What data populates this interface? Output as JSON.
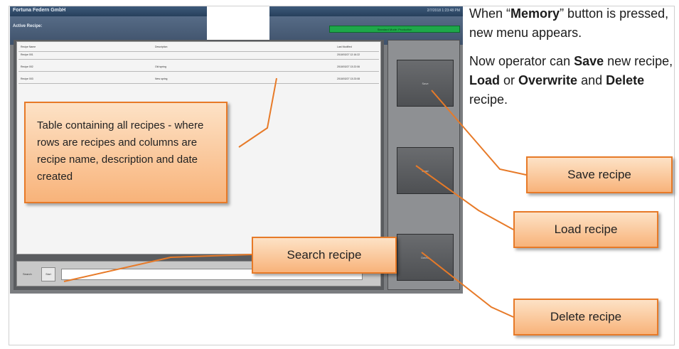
{
  "hmi": {
    "window_title": "Fortuna Federn GmbH",
    "datetime": "2/7/2018 1:23:48 PM",
    "active_recipe_label": "Active Recipe:",
    "mode_badge": "Standard Mode: Production",
    "table": {
      "headers": [
        "Recipe Name",
        "Description",
        "Last Modified"
      ],
      "rows": [
        [
          "Recipe 001",
          "",
          "2018/03/27 12:16:22"
        ],
        [
          "Recipe 002",
          "Old spring",
          "2018/03/27 13:22:06"
        ],
        [
          "Recipe 003",
          "New spring",
          "2018/03/27 13:23:08"
        ]
      ]
    },
    "search": {
      "label": "Search",
      "button": "Start",
      "input_value": ""
    },
    "side_buttons": [
      "Save",
      "Load",
      "Delete"
    ]
  },
  "callouts": {
    "table": "Table containing all recipes - where rows are recipes and columns are recipe name, description and date created",
    "search": "Search recipe",
    "save": "Save recipe",
    "load": "Load recipe",
    "delete": "Delete recipe"
  },
  "note": {
    "p1_a": "When “",
    "p1_b": "Memory",
    "p1_c": "” button is pressed, new menu appears.",
    "p2_a": "Now operator can ",
    "p2_b": "Save",
    "p2_c": " new recipe, ",
    "p2_d": "Load",
    "p2_e": " or ",
    "p2_f": "Overwrite",
    "p2_g": " and ",
    "p2_h": "Delete",
    "p2_i": " recipe."
  },
  "colors": {
    "callout_border": "#e77a28",
    "mode_badge": "#1ea84a",
    "title_bar": "#3e5a7a"
  }
}
